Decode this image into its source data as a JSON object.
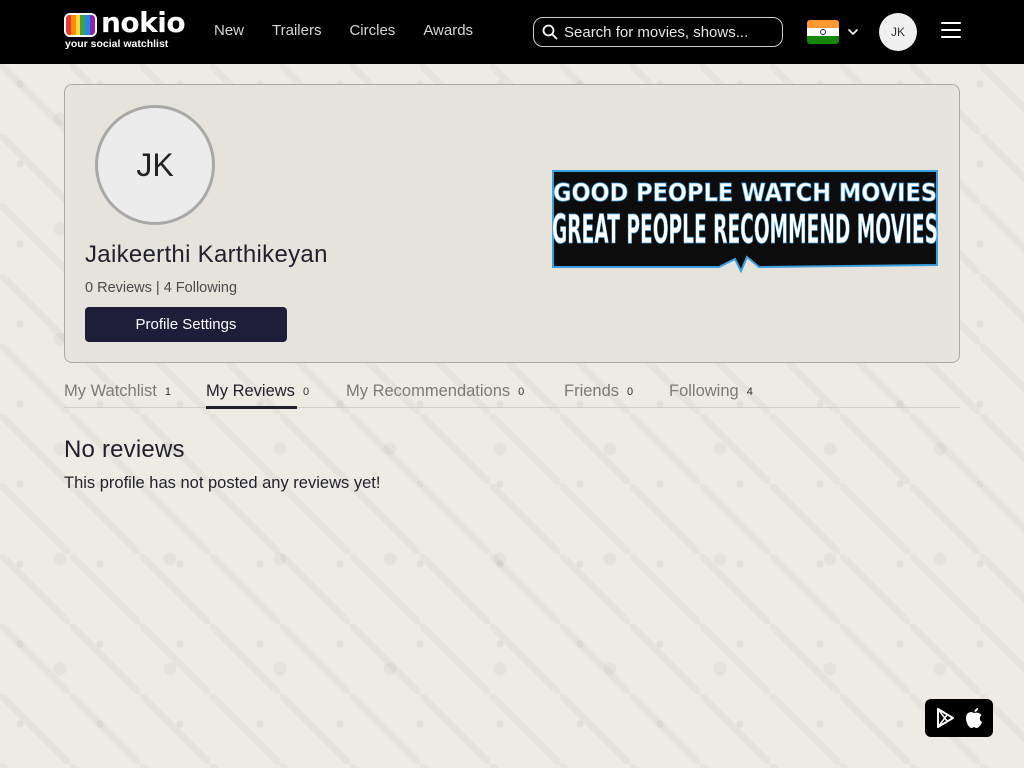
{
  "brand": {
    "name": "nokio",
    "tagline": "your social watchlist"
  },
  "nav": {
    "links": [
      "New",
      "Trailers",
      "Circles",
      "Awards"
    ],
    "search_placeholder": "Search for movies, shows...",
    "avatar_initials": "JK",
    "country_flag": "india-flag-icon"
  },
  "profile": {
    "avatar_initials": "JK",
    "name": "Jaikeerthi Karthikeyan",
    "stats": "0 Reviews | 4 Following",
    "settings_label": "Profile Settings",
    "banner": {
      "line1": "GOOD PEOPLE WATCH MOVIES",
      "line2": "GREAT PEOPLE RECOMMEND MOVIES"
    }
  },
  "tabs": [
    {
      "label": "My Watchlist",
      "count": "1"
    },
    {
      "label": "My Reviews",
      "count": "0"
    },
    {
      "label": "My Recommendations",
      "count": "0"
    },
    {
      "label": "Friends",
      "count": "0"
    },
    {
      "label": "Following",
      "count": "4"
    }
  ],
  "active_tab": "My Reviews",
  "content": {
    "title": "No reviews",
    "message": "This profile has not posted any reviews yet!"
  },
  "colors": {
    "navbar": "#000000",
    "page_bg": "#edebe3",
    "card_bg": "#e6e3dd",
    "button_bg": "#1e1e3a",
    "text_dark": "#1f1f2e",
    "banner_accent": "#3aa0e0"
  },
  "icons": [
    "search-icon",
    "chevron-down-icon",
    "menu-icon",
    "google-play-icon",
    "apple-icon"
  ]
}
